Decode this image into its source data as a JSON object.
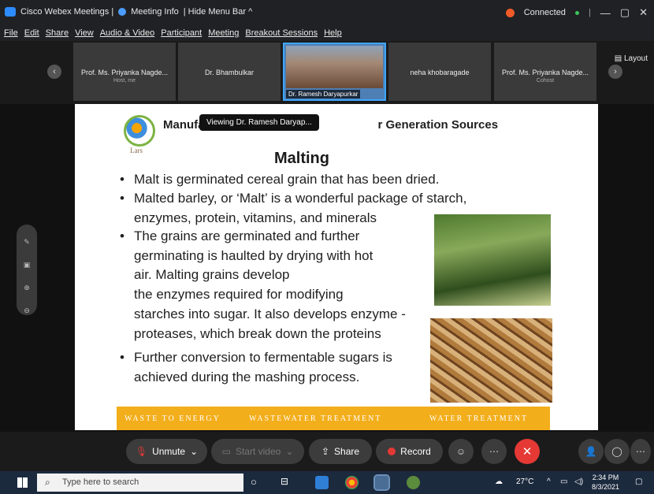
{
  "window": {
    "app_title": "Cisco Webex Meetings |",
    "meeting_info": "Meeting Info",
    "hide_menu": "| Hide Menu Bar ^",
    "status": "Connected",
    "minimize": "—",
    "restore": "▢",
    "close": "✕",
    "sep": "|"
  },
  "menu": [
    "File",
    "Edit",
    "Share",
    "View",
    "Audio & Video",
    "Participant",
    "Meeting",
    "Breakout Sessions",
    "Help"
  ],
  "participants": [
    {
      "name": "Prof. Ms. Priyanka Nagde...",
      "role": "Host, me"
    },
    {
      "name": "Dr. Bhambulkar",
      "role": ""
    },
    {
      "name": "Dr. Ramesh Daryapurkar",
      "role": ""
    },
    {
      "name": "neha khobaragade",
      "role": ""
    },
    {
      "name": "Prof. Ms. Priyanka Nagde...",
      "role": "Cohost"
    }
  ],
  "layout_label": "Layout",
  "tooltip": "Viewing Dr. Ramesh Daryap...",
  "slide": {
    "header_left": "Manufacturing pr",
    "header_right": "r Generation Sources",
    "logo_text": "Lars",
    "title": "Malting",
    "lines": [
      "Malt is germinated cereal grain that has been dried.",
      "Malted barley, or ‘Malt’ is a wonderful package of starch,",
      "enzymes, protein, vitamins, and minerals",
      "The grains are  germinated and further",
      "germinating is haulted by drying with hot",
      "air. Malting grains develop",
      "the enzymes required for modifying",
      "starches into sugar. It also develops enzyme -",
      "proteases, which break down the proteins",
      "Further conversion to fermentable sugars is",
      "achieved during the mashing process."
    ],
    "footer": [
      "WASTE TO ENERGY",
      "WASTEWATER TREATMENT",
      "WATER TREATMENT"
    ]
  },
  "controls": {
    "unmute": "Unmute",
    "start_video": "Start video",
    "share": "Share",
    "record": "Record"
  },
  "taskbar": {
    "search_placeholder": "Type here to search",
    "temperature": "27°C",
    "time": "2:34 PM",
    "date": "8/3/2021"
  }
}
